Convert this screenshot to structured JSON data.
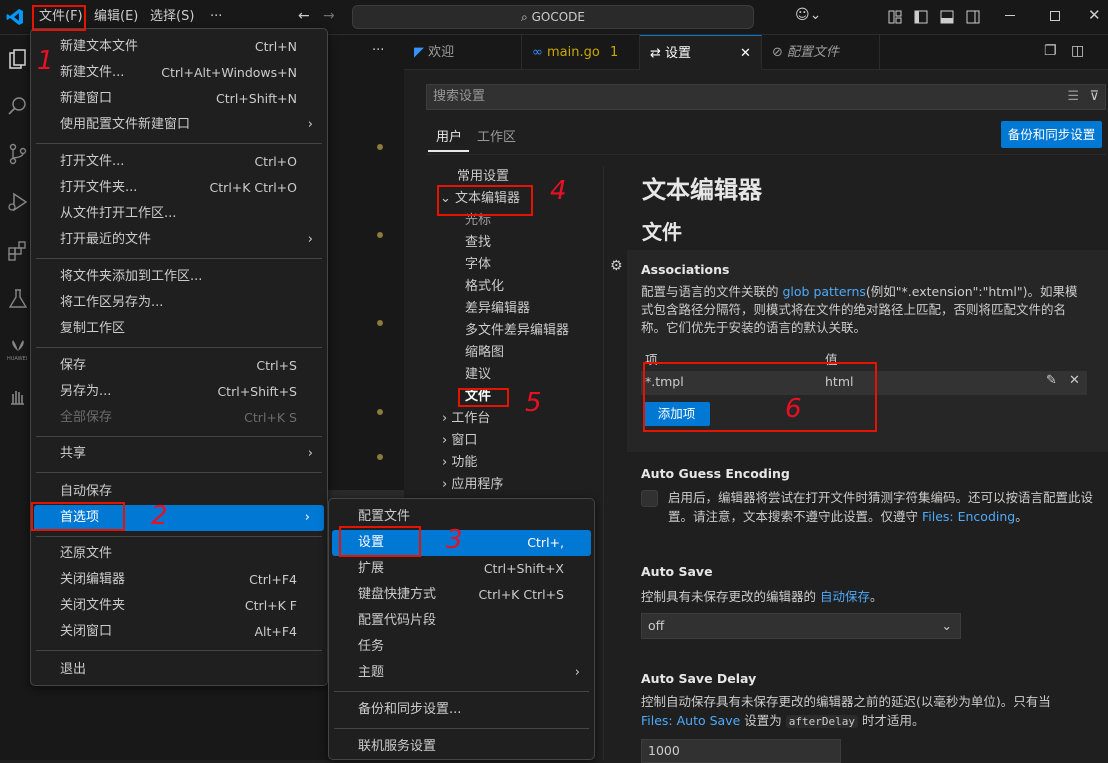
{
  "titlebar": {
    "menus": [
      "文件(F)",
      "编辑(E)",
      "选择(S)",
      "···"
    ],
    "search": "GOCODE",
    "copilot": "⌄"
  },
  "tabs": [
    {
      "label": "欢迎",
      "icon": "vscode-icon"
    },
    {
      "label": "main.go",
      "badge": "1",
      "icon": "go-icon"
    },
    {
      "label": "设置",
      "icon": "settings-icon"
    },
    {
      "label": "配置文件",
      "icon": "profile-icon"
    }
  ],
  "settings": {
    "search_placeholder": "搜索设置",
    "scope_tabs": [
      "用户",
      "工作区"
    ],
    "backup_button": "备份和同步设置",
    "toc": [
      "常用设置",
      "文本编辑器",
      "光标",
      "查找",
      "字体",
      "格式化",
      "差异编辑器",
      "多文件差异编辑器",
      "缩略图",
      "建议",
      "文件",
      "工作台",
      "窗口",
      "功能",
      "应用程序"
    ],
    "heading1": "文本编辑器",
    "heading2": "文件",
    "associations": {
      "title": "Associations",
      "desc_pre": "配置与语言的文件关联的 ",
      "desc_link": "glob patterns",
      "desc_post": "(例如\"*.extension\":\"html\")。如果模式包含路径分隔符，则模式将在文件的绝对路径上匹配，否则将匹配文件的名称。它们优先于安装的语言的默认关联。",
      "col_item": "项",
      "col_value": "值",
      "row_item": "*.tmpl",
      "row_value": "html",
      "add_button": "添加项"
    },
    "guess": {
      "title": "Auto Guess Encoding",
      "desc_pre": "启用后，编辑器将尝试在打开文件时猜测字符集编码。还可以按语言配置此设置。请注意，文本搜索不遵守此设置。仅遵守 ",
      "desc_link": "Files: Encoding",
      "desc_post": "。"
    },
    "autosave": {
      "title": "Auto Save",
      "desc_pre": "控制具有未保存更改的编辑器的 ",
      "desc_link": "自动保存",
      "desc_post": "。",
      "value": "off"
    },
    "autosave_delay": {
      "title": "Auto Save Delay",
      "desc_pre": "控制自动保存具有未保存更改的编辑器之前的延迟(以毫秒为单位)。只有当 ",
      "desc_link": "Files: Auto Save",
      "desc_mid": " 设置为 ",
      "desc_code": "afterDelay",
      "desc_post": " 时才适用。",
      "value": "1000"
    }
  },
  "file_menu": {
    "items": [
      {
        "label": "新建文本文件",
        "sc": "Ctrl+N"
      },
      {
        "label": "新建文件...",
        "sc": "Ctrl+Alt+Windows+N"
      },
      {
        "label": "新建窗口",
        "sc": "Ctrl+Shift+N"
      },
      {
        "label": "使用配置文件新建窗口",
        "sc": "›"
      },
      {
        "label": "打开文件...",
        "sc": "Ctrl+O"
      },
      {
        "label": "打开文件夹...",
        "sc": "Ctrl+K Ctrl+O"
      },
      {
        "label": "从文件打开工作区...",
        "sc": ""
      },
      {
        "label": "打开最近的文件",
        "sc": "›"
      },
      {
        "label": "将文件夹添加到工作区...",
        "sc": ""
      },
      {
        "label": "将工作区另存为...",
        "sc": ""
      },
      {
        "label": "复制工作区",
        "sc": ""
      },
      {
        "label": "保存",
        "sc": "Ctrl+S"
      },
      {
        "label": "另存为...",
        "sc": "Ctrl+Shift+S"
      },
      {
        "label": "全部保存",
        "sc": "Ctrl+K S"
      },
      {
        "label": "共享",
        "sc": "›"
      },
      {
        "label": "自动保存",
        "sc": ""
      },
      {
        "label": "首选项",
        "sc": "›"
      },
      {
        "label": "还原文件",
        "sc": ""
      },
      {
        "label": "关闭编辑器",
        "sc": "Ctrl+F4"
      },
      {
        "label": "关闭文件夹",
        "sc": "Ctrl+K F"
      },
      {
        "label": "关闭窗口",
        "sc": "Alt+F4"
      },
      {
        "label": "退出",
        "sc": ""
      }
    ]
  },
  "pref_menu": {
    "items": [
      {
        "label": "配置文件",
        "sc": ""
      },
      {
        "label": "设置",
        "sc": "Ctrl+,"
      },
      {
        "label": "扩展",
        "sc": "Ctrl+Shift+X"
      },
      {
        "label": "键盘快捷方式",
        "sc": "Ctrl+K Ctrl+S"
      },
      {
        "label": "配置代码片段",
        "sc": ""
      },
      {
        "label": "任务",
        "sc": ""
      },
      {
        "label": "主题",
        "sc": "›"
      },
      {
        "label": "备份和同步设置...",
        "sc": ""
      },
      {
        "label": "联机服务设置",
        "sc": ""
      }
    ]
  },
  "annotations": [
    "1",
    "2",
    "3",
    "4",
    "5",
    "6"
  ],
  "colors": {
    "accent": "#0078d4",
    "annotation": "#e51400"
  }
}
